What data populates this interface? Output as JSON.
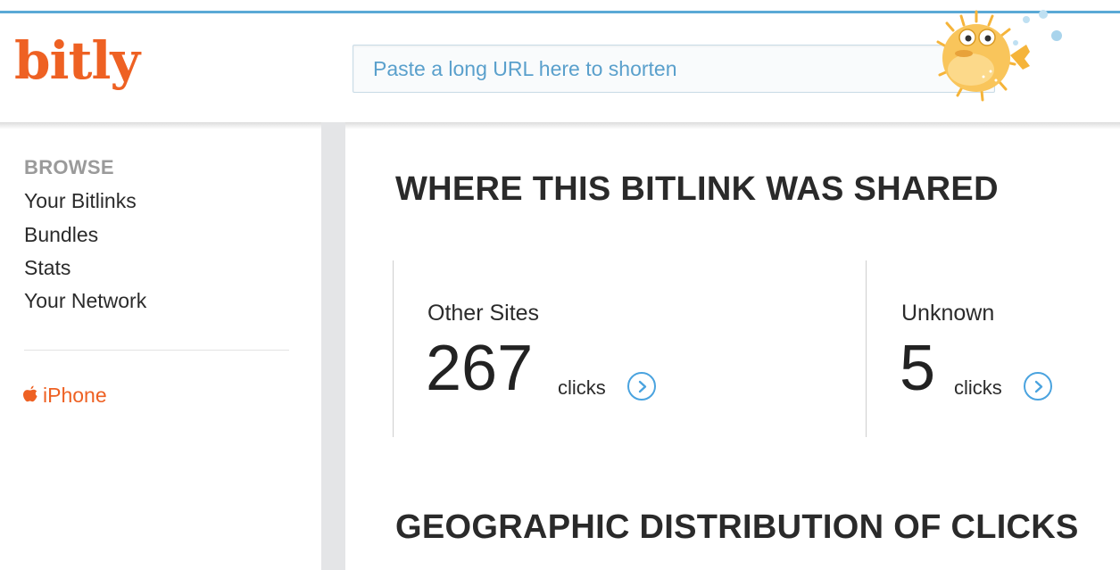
{
  "header": {
    "logo_text": "bitly",
    "search_placeholder": "Paste a long URL here to shorten"
  },
  "sidebar": {
    "browse_label": "BROWSE",
    "items": [
      {
        "label": "Your Bitlinks"
      },
      {
        "label": "Bundles"
      },
      {
        "label": "Stats"
      },
      {
        "label": "Your Network"
      }
    ],
    "iphone_label": "iPhone"
  },
  "main": {
    "shared_title": "WHERE THIS BITLINK WAS SHARED",
    "stats": [
      {
        "label": "Other Sites",
        "value": "267",
        "unit": "clicks"
      },
      {
        "label": "Unknown",
        "value": "5",
        "unit": "clicks"
      }
    ],
    "geo_title": "GEOGRAPHIC DISTRIBUTION OF CLICKS"
  },
  "colors": {
    "brand_orange": "#ee6123",
    "accent_blue": "#4aa3df"
  },
  "icons": [
    "pufferfish-mascot-icon",
    "apple-icon",
    "chevron-right-circle-icon"
  ]
}
